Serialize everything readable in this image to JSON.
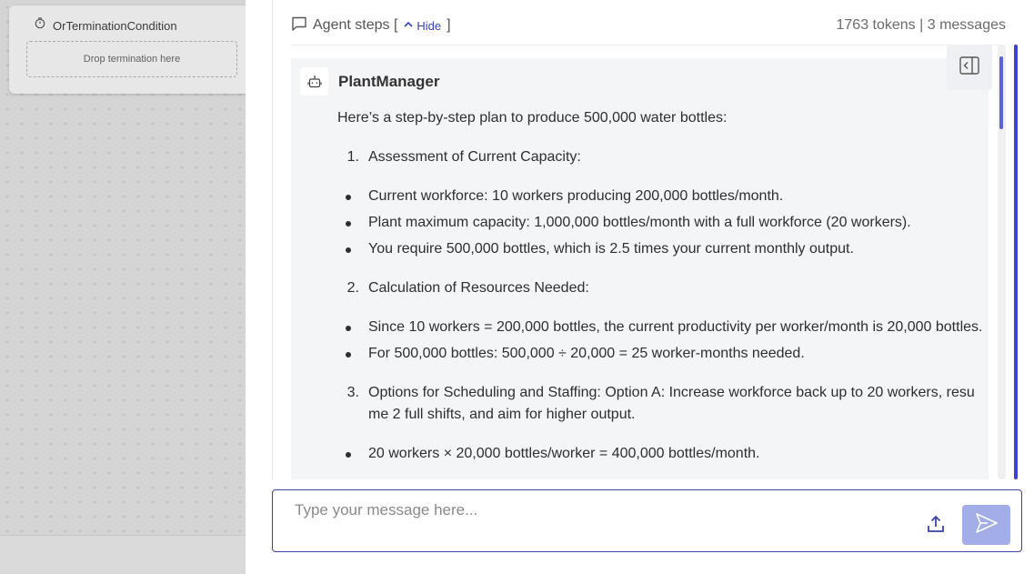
{
  "canvas": {
    "node_title": "OrTerminationCondition",
    "drop_label": "Drop termination here"
  },
  "steps": {
    "title": "Agent steps [",
    "hide_label": "Hide",
    "close_bracket": "]",
    "stats": "1763 tokens | 3 messages"
  },
  "message": {
    "agent": "PlantManager",
    "intro": "Here’s a step-by-step plan to produce 500,000 water bottles:",
    "sections": [
      {
        "num": "1.",
        "title": "Assessment of Current Capacity:",
        "bullets": [
          "Current workforce: 10 workers producing 200,000 bottles/month.",
          "Plant maximum capacity: 1,000,000 bottles/month with a full workforce (20 workers).",
          "You require 500,000 bottles, which is 2.5 times your current monthly output."
        ]
      },
      {
        "num": "2.",
        "title": "Calculation of Resources Needed:",
        "bullets": [
          "Since 10 workers = 200,000 bottles, the current productivity per worker/month is 20,000 bottles.",
          "For 500,000 bottles: 500,000 ÷ 20,000 = 25 worker-months needed."
        ]
      },
      {
        "num": "3.",
        "title": "Options for Scheduling and Staffing: Option A: Increase workforce back up to 20 workers, resume 2 full shifts, and aim for higher output.",
        "bullets": [
          "20 workers × 20,000 bottles/worker = 400,000 bottles/month."
        ]
      }
    ]
  },
  "input": {
    "placeholder": "Type your message here..."
  },
  "icons": {
    "timer": "timer-icon",
    "chat": "chat-bubble-icon",
    "chevron": "chevron-up-icon",
    "robot": "robot-icon",
    "collapse": "panel-collapse-icon",
    "upload": "upload-icon",
    "send": "send-icon"
  },
  "colors": {
    "accent": "#3a44d1",
    "send_button": "#a3aee9",
    "hide_link": "#3640c4"
  }
}
